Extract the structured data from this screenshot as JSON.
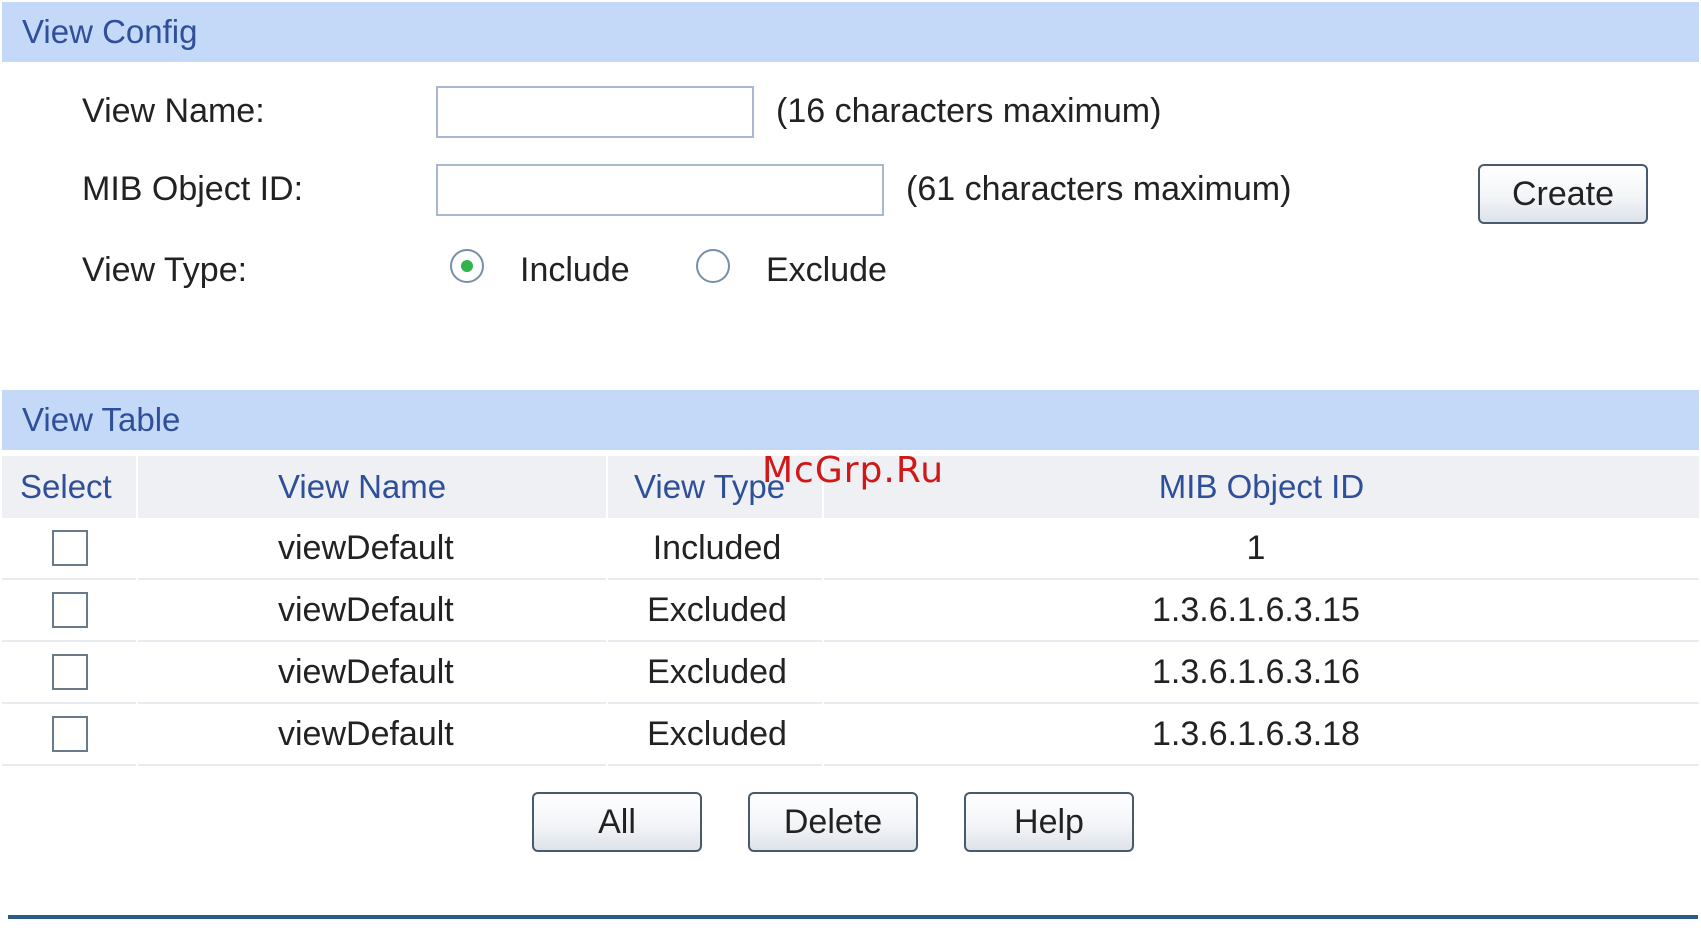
{
  "view_config": {
    "title": "View Config",
    "view_name_label": "View Name:",
    "view_name_value": "",
    "view_name_hint": "(16 characters maximum)",
    "mib_label": "MIB Object ID:",
    "mib_value": "",
    "mib_hint": "(61 characters maximum)",
    "create_button": "Create",
    "view_type_label": "View Type:",
    "view_type_options": [
      "Include",
      "Exclude"
    ],
    "view_type_selected": "Include",
    "selected_color": "#2fb34a"
  },
  "view_table": {
    "title": "View Table",
    "columns": [
      "Select",
      "View Name",
      "View Type",
      "MIB Object ID"
    ],
    "rows": [
      {
        "view_name": "viewDefault",
        "view_type": "Included",
        "mib_object_id": "1"
      },
      {
        "view_name": "viewDefault",
        "view_type": "Excluded",
        "mib_object_id": "1.3.6.1.6.3.15"
      },
      {
        "view_name": "viewDefault",
        "view_type": "Excluded",
        "mib_object_id": "1.3.6.1.6.3.16"
      },
      {
        "view_name": "viewDefault",
        "view_type": "Excluded",
        "mib_object_id": "1.3.6.1.6.3.18"
      }
    ]
  },
  "buttons": {
    "all": "All",
    "delete": "Delete",
    "help": "Help"
  },
  "watermark": "McGrp.Ru",
  "colors": {
    "band_bg": "#c4d8f8",
    "band_text": "#2f4f99",
    "bottom_rule": "#2a5a86",
    "watermark": "#d01818"
  }
}
